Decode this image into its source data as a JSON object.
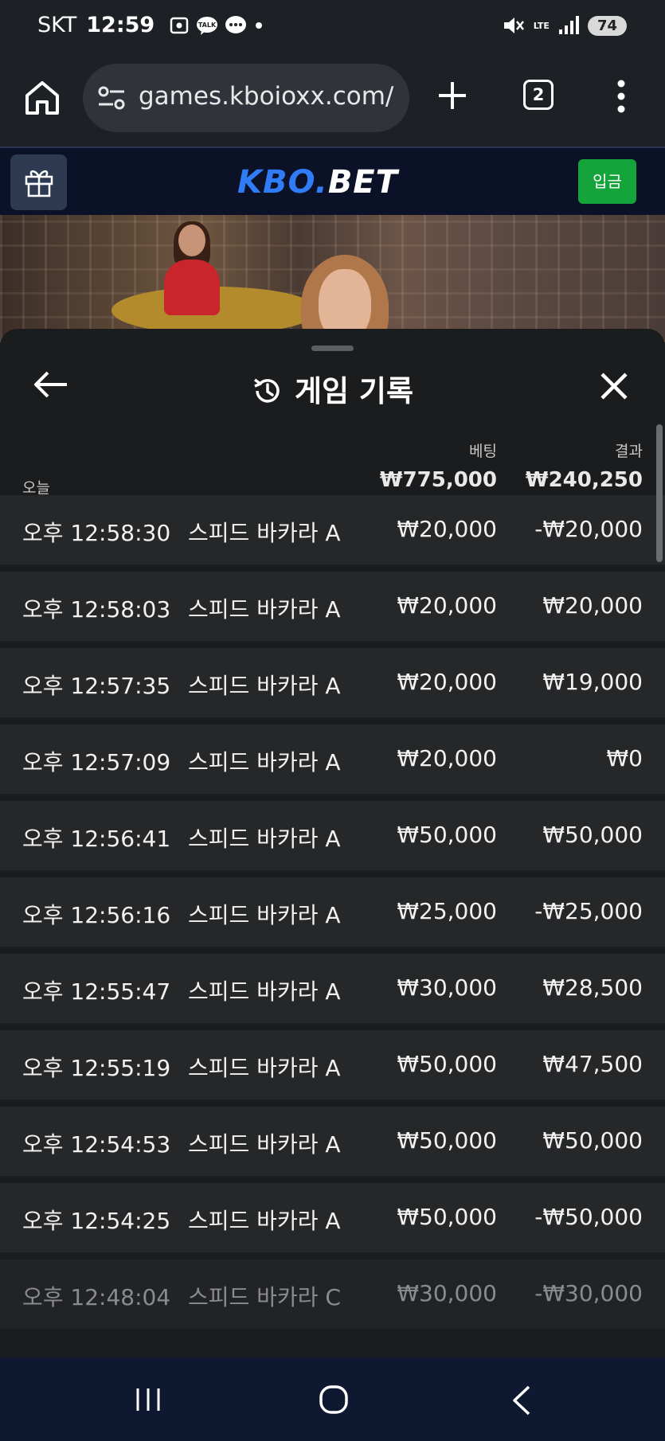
{
  "status_bar": {
    "carrier": "SKT",
    "time": "12:59",
    "network": "LTE",
    "battery": "74"
  },
  "browser": {
    "url": "games.kboioxx.com/",
    "tab_count": "2"
  },
  "site": {
    "logo_part1": "KBO.",
    "logo_part2": "BET",
    "deposit_label": "입금"
  },
  "sheet": {
    "title": "게임 기록",
    "today_label": "오늘",
    "bet_header": "베팅",
    "result_header": "결과",
    "total_bet": "₩775,000",
    "total_result": "₩240,250",
    "rows": [
      {
        "time": "오후 12:58:30",
        "game": "스피드 바카라 A",
        "bet": "₩20,000",
        "result": "-₩20,000"
      },
      {
        "time": "오후 12:58:03",
        "game": "스피드 바카라 A",
        "bet": "₩20,000",
        "result": "₩20,000"
      },
      {
        "time": "오후 12:57:35",
        "game": "스피드 바카라 A",
        "bet": "₩20,000",
        "result": "₩19,000"
      },
      {
        "time": "오후 12:57:09",
        "game": "스피드 바카라 A",
        "bet": "₩20,000",
        "result": "₩0"
      },
      {
        "time": "오후 12:56:41",
        "game": "스피드 바카라 A",
        "bet": "₩50,000",
        "result": "₩50,000"
      },
      {
        "time": "오후 12:56:16",
        "game": "스피드 바카라 A",
        "bet": "₩25,000",
        "result": "-₩25,000"
      },
      {
        "time": "오후 12:55:47",
        "game": "스피드 바카라 A",
        "bet": "₩30,000",
        "result": "₩28,500"
      },
      {
        "time": "오후 12:55:19",
        "game": "스피드 바카라 A",
        "bet": "₩50,000",
        "result": "₩47,500"
      },
      {
        "time": "오후 12:54:53",
        "game": "스피드 바카라 A",
        "bet": "₩50,000",
        "result": "₩50,000"
      },
      {
        "time": "오후 12:54:25",
        "game": "스피드 바카라 A",
        "bet": "₩50,000",
        "result": "-₩50,000"
      },
      {
        "time": "오후 12:48:04",
        "game": "스피드 바카라 C",
        "bet": "₩30,000",
        "result": "-₩30,000"
      }
    ]
  },
  "colors": {
    "accent_blue": "#2f7cf6",
    "deposit_green": "#15a33b",
    "header_navy": "#0b1228"
  }
}
